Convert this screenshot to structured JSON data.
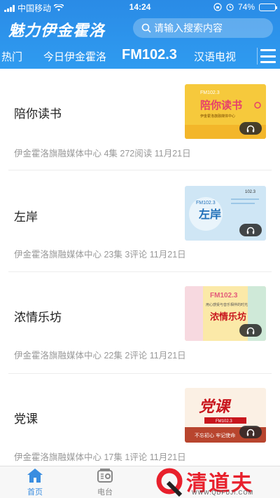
{
  "status_bar": {
    "carrier": "中国移动",
    "time": "14:24",
    "battery_text": "74%",
    "battery_level": 0.74
  },
  "header": {
    "logo_text": "魅力伊金霍洛",
    "search_placeholder": "请输入搜索内容"
  },
  "tabs": [
    {
      "label": "热门"
    },
    {
      "label": "今日伊金霍洛"
    },
    {
      "label": "FM102.3",
      "active": true
    },
    {
      "label": "汉语电视"
    }
  ],
  "items": [
    {
      "title": "陪你读书",
      "meta": "伊金霍洛旗融媒体中心 4集 272阅读 11月21日",
      "thumb": {
        "top_text": "FM102.3",
        "main_text": "陪你读书",
        "sub_text": "伊金霍洛旗融媒体中心",
        "bg": "#f6c93c",
        "accent": "#e6406b"
      }
    },
    {
      "title": "左岸",
      "meta": "伊金霍洛旗融媒体中心 23集 3评论 11月21日",
      "thumb": {
        "top_text": "FM102.3",
        "main_text": "左岸",
        "sub_text": "102.3",
        "bg": "#cfe6f5",
        "accent": "#1f6fb8"
      }
    },
    {
      "title": "浓情乐坊",
      "meta": "伊金霍洛旗融媒体中心 22集 2评论 11月21日",
      "thumb": {
        "top_text": "FM102.3",
        "main_text": "浓情乐坊",
        "sub_text": "用心感受与音乐相伴的时光",
        "bg": "#fbe9a8",
        "accent": "#e35a7a"
      }
    },
    {
      "title": "党课",
      "meta": "伊金霍洛旗融媒体中心 17集 1评论 11月21日",
      "thumb": {
        "top_text": "FM102.3",
        "main_text": "党课",
        "sub_text": "不忘初心 牢记使命",
        "bg": "#fbf0e4",
        "accent": "#c8161d"
      }
    }
  ],
  "tabbar": {
    "home_label": "首页",
    "radio_label": "电台"
  },
  "watermark": {
    "text": "清道夫",
    "url": "WWW.QDFUJI.COM"
  },
  "colors": {
    "brand_blue": "#2f9bf0",
    "active_tab": "#3a8de0",
    "inactive_tab": "#888888"
  }
}
